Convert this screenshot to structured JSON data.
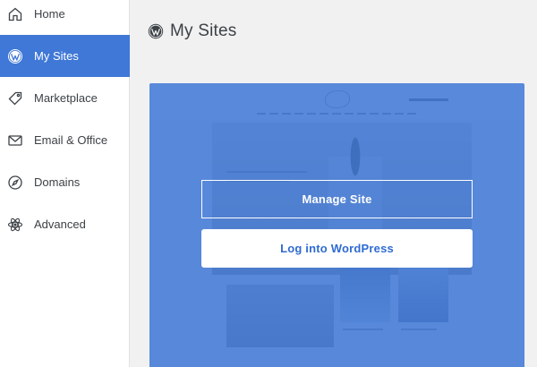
{
  "sidebar": {
    "items": [
      {
        "label": "Home",
        "icon": "home-icon",
        "active": false
      },
      {
        "label": "My Sites",
        "icon": "wordpress-icon",
        "active": true
      },
      {
        "label": "Marketplace",
        "icon": "tag-icon",
        "active": false
      },
      {
        "label": "Email & Office",
        "icon": "envelope-icon",
        "active": false
      },
      {
        "label": "Domains",
        "icon": "compass-icon",
        "active": false
      },
      {
        "label": "Advanced",
        "icon": "atom-icon",
        "active": false
      }
    ]
  },
  "header": {
    "title": "My Sites",
    "icon": "wordpress-icon"
  },
  "site_card": {
    "manage_label": "Manage Site",
    "login_label": "Log into WordPress"
  },
  "colors": {
    "accent": "#3f78d6",
    "overlay": "#3d76d5",
    "text": "#3c4146",
    "background": "#f1f1f1"
  }
}
